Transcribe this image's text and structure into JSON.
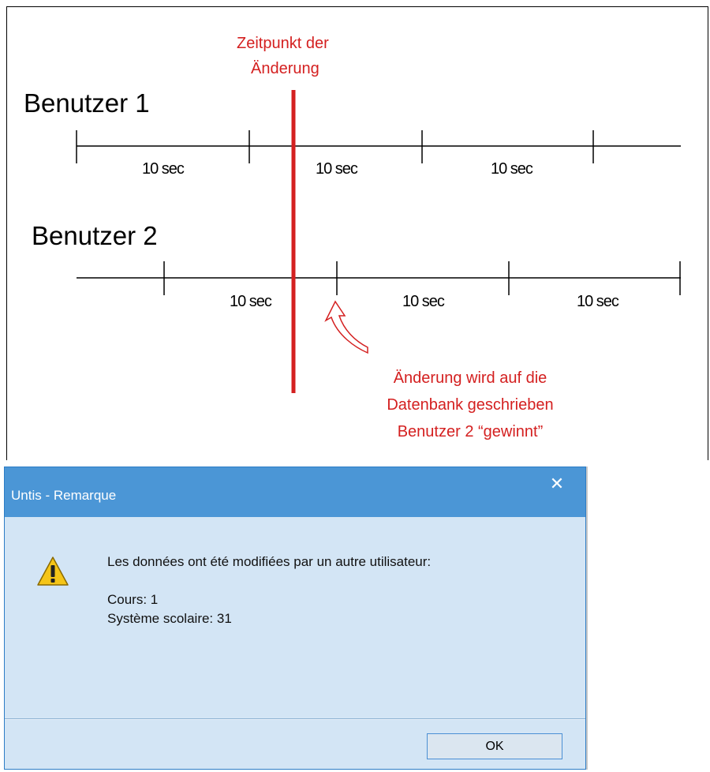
{
  "diagram": {
    "user1_label": "Benutzer 1",
    "user2_label": "Benutzer 2",
    "interval_label": "10 sec",
    "change_time_line1": "Zeitpunkt der",
    "change_time_line2": "Änderung",
    "note_line1": "Änderung wird auf die",
    "note_line2": "Datenbank geschrieben",
    "note_line3": "Benutzer 2 “gewinnt”",
    "colors": {
      "accent": "#d42020",
      "line": "#000000"
    }
  },
  "dialog": {
    "title": "Untis - Remarque",
    "close_glyph": "✕",
    "icon": "warning-icon",
    "message": "Les données ont été modifiées par un autre utilisateur:",
    "line_cours": "Cours: 1",
    "line_systeme": "Système scolaire: 31",
    "ok_label": "OK",
    "colors": {
      "titlebar": "#4b96d6",
      "body": "#d3e5f5"
    }
  }
}
